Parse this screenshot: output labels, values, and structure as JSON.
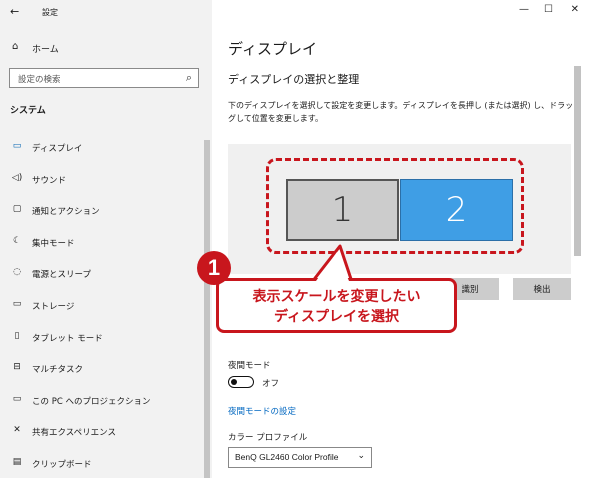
{
  "window": {
    "title": "設定",
    "controls": {
      "minimize": "—",
      "maximize": "☐",
      "close": "✕"
    }
  },
  "sidebar": {
    "back": "←",
    "home": {
      "label": "ホーム",
      "icon": "home-icon"
    },
    "search": {
      "placeholder": "設定の検索",
      "icon": "search-icon"
    },
    "section_title": "システム",
    "items": [
      {
        "label": "ディスプレイ",
        "icon": "monitor-icon",
        "glyph": "▭",
        "active": true
      },
      {
        "label": "サウンド",
        "icon": "speaker-icon",
        "glyph": "🔈"
      },
      {
        "label": "通知とアクション",
        "icon": "notification-icon",
        "glyph": "▢"
      },
      {
        "label": "集中モード",
        "icon": "moon-icon",
        "glyph": "☾"
      },
      {
        "label": "電源とスリープ",
        "icon": "power-icon",
        "glyph": "⏻"
      },
      {
        "label": "ストレージ",
        "icon": "storage-icon",
        "glyph": "▭"
      },
      {
        "label": "タブレット モード",
        "icon": "tablet-icon",
        "glyph": "▯"
      },
      {
        "label": "マルチタスク",
        "icon": "multitask-icon",
        "glyph": "⊟"
      },
      {
        "label": "この PC へのプロジェクション",
        "icon": "projection-icon",
        "glyph": "▭"
      },
      {
        "label": "共有エクスペリエンス",
        "icon": "shared-experience-icon",
        "glyph": "✕"
      },
      {
        "label": "クリップボード",
        "icon": "clipboard-icon",
        "glyph": "▤"
      }
    ]
  },
  "main": {
    "title": "ディスプレイ",
    "subtitle": "ディスプレイの選択と整理",
    "description": "下のディスプレイを選択して設定を変更します。ディスプレイを長押し (または選択) し、ドラッグして位置を変更します。",
    "monitors": [
      {
        "label": "1",
        "selected": false
      },
      {
        "label": "2",
        "selected": true
      }
    ],
    "identify_button": "識別",
    "detect_button": "検出",
    "night_mode": {
      "label": "夜間モード",
      "state": "オフ",
      "on": false
    },
    "night_mode_link": "夜間モードの設定",
    "color_profile": {
      "label": "カラー プロファイル",
      "value": "BenQ GL2460 Color Profile"
    }
  },
  "annotation": {
    "number": "1",
    "line1": "表示スケールを変更したい",
    "line2": "ディスプレイを選択",
    "color": "#c8161d"
  },
  "colors": {
    "accent": "#0067c0",
    "selected_monitor": "#3f9ee5",
    "sidebar_bg": "#f2f2f2"
  }
}
